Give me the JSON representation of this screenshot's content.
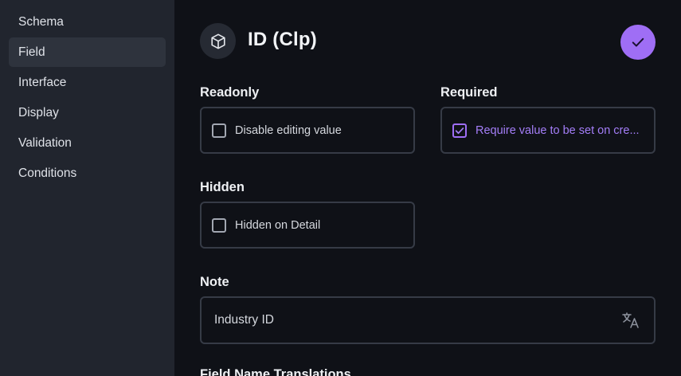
{
  "sidebar": {
    "items": [
      {
        "label": "Schema"
      },
      {
        "label": "Field"
      },
      {
        "label": "Interface"
      },
      {
        "label": "Display"
      },
      {
        "label": "Validation"
      },
      {
        "label": "Conditions"
      }
    ],
    "active": "Field"
  },
  "header": {
    "title": "ID (Clp)",
    "icon": "cube-icon",
    "save_icon": "check-icon"
  },
  "fields": {
    "readonly": {
      "label": "Readonly",
      "option": "Disable editing value",
      "checked": false
    },
    "required": {
      "label": "Required",
      "option": "Require value to be set on cre...",
      "checked": true
    },
    "hidden": {
      "label": "Hidden",
      "option": "Hidden on Detail",
      "checked": false
    },
    "note": {
      "label": "Note",
      "value": "Industry ID",
      "icon": "translate-icon"
    },
    "field_name_translations": {
      "label": "Field Name Translations"
    }
  },
  "colors": {
    "accent": "#9f6ef5",
    "background": "#0f1117",
    "sidebar": "#21252e",
    "border": "#363b46"
  }
}
